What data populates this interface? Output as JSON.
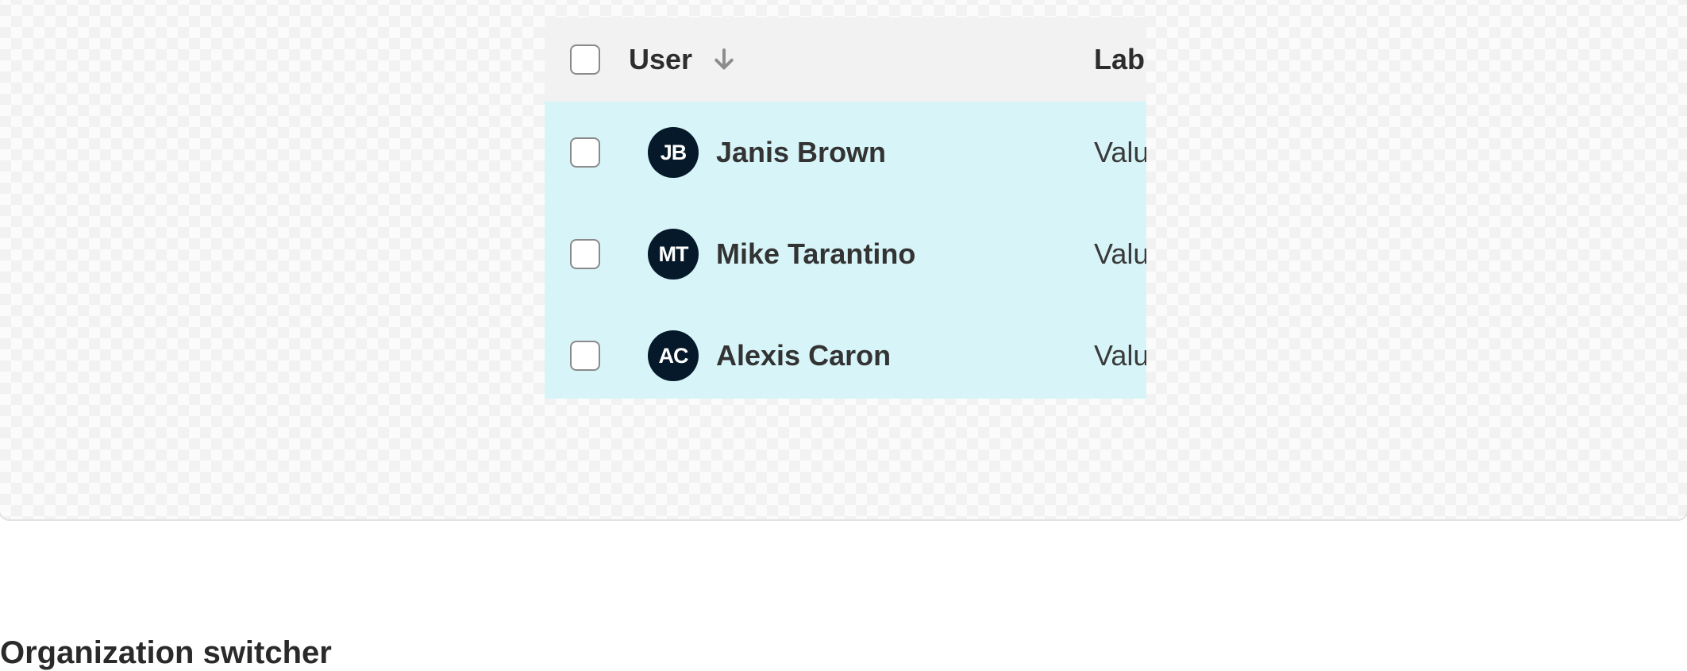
{
  "table": {
    "header": {
      "user_label": "User",
      "second_column_label": "Lab"
    },
    "rows": [
      {
        "initials": "JB",
        "name": "Janis Brown",
        "value": "Valu"
      },
      {
        "initials": "MT",
        "name": "Mike Tarantino",
        "value": "Valu"
      },
      {
        "initials": "AC",
        "name": "Alexis Caron",
        "value": "Valu"
      }
    ]
  },
  "section": {
    "title": "Organization switcher"
  },
  "colors": {
    "row_highlight": "#d7f5f9",
    "header_background": "#f2f2f2",
    "avatar_background": "#06192a"
  },
  "icons": {
    "sort": "arrow-down-icon"
  }
}
